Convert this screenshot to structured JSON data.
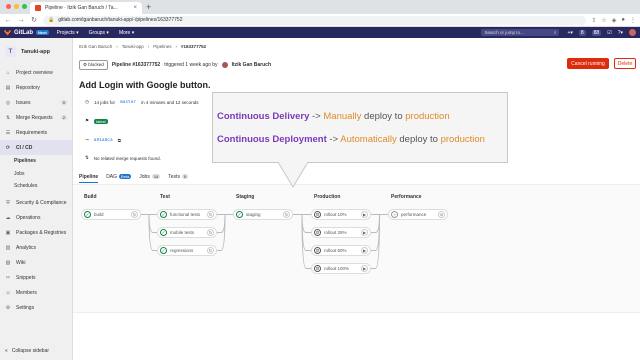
{
  "browser": {
    "tab_title": "Pipeline · Itzik Gan Baruch / Ta...",
    "url": "gitlab.com/iganbaruch/tanuki-app/-/pipelines/163377752"
  },
  "gitlab": {
    "logo": "GitLab",
    "next": "Next",
    "menu": [
      "Projects ▾",
      "Groups ▾",
      "More ▾"
    ],
    "search_placeholder": "Search or jump to...",
    "counts": [
      "8",
      "88"
    ]
  },
  "sidebar": {
    "project_initial": "T",
    "project_name": "Tanuki-app",
    "items": [
      {
        "label": "Project overview",
        "icon": "⌂"
      },
      {
        "label": "Repository",
        "icon": "▤"
      },
      {
        "label": "Issues",
        "icon": "◎",
        "count": "0"
      },
      {
        "label": "Merge Requests",
        "icon": "⇅",
        "count": "2"
      },
      {
        "label": "Requirements",
        "icon": "☰"
      },
      {
        "label": "CI / CD",
        "icon": "⟳"
      }
    ],
    "sub": [
      "Pipelines",
      "Jobs",
      "Schedules"
    ],
    "items2": [
      {
        "label": "Security & Compliance",
        "icon": "⛨"
      },
      {
        "label": "Operations",
        "icon": "☁"
      },
      {
        "label": "Packages & Registries",
        "icon": "▣"
      },
      {
        "label": "Analytics",
        "icon": "▥"
      },
      {
        "label": "Wiki",
        "icon": "▧"
      },
      {
        "label": "Snippets",
        "icon": "✂"
      },
      {
        "label": "Members",
        "icon": "☺"
      },
      {
        "label": "Settings",
        "icon": "⚙"
      }
    ],
    "collapse": "Collapse sidebar"
  },
  "breadcrumb": [
    "Itzik Gan Baruch",
    "Tanuki-app",
    "Pipelines",
    "#163377752"
  ],
  "pipeline": {
    "status": "blocked",
    "id_text": "Pipeline #163377752",
    "triggered": "triggered 1 week ago by",
    "user": "Itzik Gan Baruch",
    "cancel": "Cancel running",
    "delete": "Delete",
    "title": "Add Login with Google button.",
    "jobs_text_a": "14 jobs for",
    "branch": "master",
    "jobs_text_b": "in 4 minutes and 12 seconds",
    "latest": "latest",
    "sha": "a91a8ca",
    "no_mr": "No related merge requests found."
  },
  "tabs": [
    {
      "label": "Pipeline"
    },
    {
      "label": "DAG",
      "pill": "Beta"
    },
    {
      "label": "Jobs",
      "pill": "14"
    },
    {
      "label": "Tests",
      "pill": "0"
    }
  ],
  "stages": [
    {
      "title": "Build",
      "jobs": [
        {
          "name": "build",
          "kind": "ok"
        }
      ]
    },
    {
      "title": "Test",
      "jobs": [
        {
          "name": "functional tests",
          "kind": "ok"
        },
        {
          "name": "mobile tests",
          "kind": "ok"
        },
        {
          "name": "regressions",
          "kind": "ok"
        }
      ]
    },
    {
      "title": "Staging",
      "jobs": [
        {
          "name": "staging",
          "kind": "ok"
        }
      ]
    },
    {
      "title": "Production",
      "jobs": [
        {
          "name": "rollout 10%",
          "kind": "man"
        },
        {
          "name": "rollout 25%",
          "kind": "man"
        },
        {
          "name": "rollout 50%",
          "kind": "man"
        },
        {
          "name": "rollout 100%",
          "kind": "man"
        }
      ]
    },
    {
      "title": "Performance",
      "jobs": [
        {
          "name": "performance",
          "kind": "skip"
        }
      ]
    }
  ],
  "overlay": {
    "line1": {
      "bold": "Continuous Delivery",
      "arrow": " -> ",
      "hl": "Manually",
      "rest": " deploy to ",
      "hl2": "production"
    },
    "line2": {
      "bold": "Continuous Deployment",
      "arrow": " -> ",
      "hl": "Automatically",
      "rest": " deploy to ",
      "hl2": "production"
    }
  },
  "colors": {
    "gitlab_nav": "#292961",
    "accent_purple": "#7b3ab7",
    "accent_orange": "#e08a2a",
    "success": "#108548",
    "danger": "#dd2b0e"
  }
}
